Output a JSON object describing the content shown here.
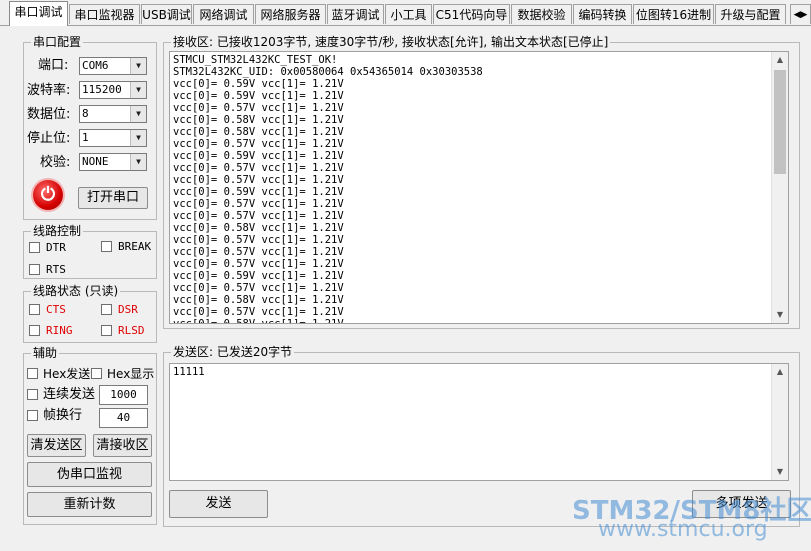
{
  "tabs": [
    "串口调试",
    "串口监视器",
    "USB调试",
    "网络调试",
    "网络服务器",
    "蓝牙调试",
    "小工具",
    "C51代码向导",
    "数据校验",
    "编码转换",
    "位图转16进制",
    "升级与配置"
  ],
  "serial_config": {
    "legend": "串口配置",
    "port_label": "端口:",
    "port_value": "COM6",
    "baud_label": "波特率:",
    "baud_value": "115200",
    "databits_label": "数据位:",
    "databits_value": "8",
    "stopbits_label": "停止位:",
    "stopbits_value": "1",
    "parity_label": "校验:",
    "parity_value": "NONE",
    "open_button": "打开串口"
  },
  "line_control": {
    "legend": "线路控制",
    "dtr": "DTR",
    "break": "BREAK",
    "rts": "RTS"
  },
  "line_status": {
    "legend": "线路状态 (只读)",
    "cts": "CTS",
    "dsr": "DSR",
    "ring": "RING",
    "rlsd": "RLSD"
  },
  "assist": {
    "legend": "辅助",
    "hex_send": "Hex发送",
    "hex_display": "Hex显示",
    "continuous_send": "连续发送",
    "continuous_interval": "1000",
    "frame_wrap": "帧换行",
    "frame_value": "40",
    "clear_send": "清发送区",
    "clear_receive": "清接收区",
    "pseudo_monitor": "伪串口监视",
    "recount": "重新计数"
  },
  "receive": {
    "legend": "接收区: 已接收1203字节, 速度30字节/秒, 接收状态[允许], 输出文本状态[已停止]",
    "lines": [
      "STMCU_STM32L432KC_TEST_OK!",
      "STM32L432KC_UID: 0x00580064 0x54365014 0x30303538",
      "vcc[0]= 0.59V vcc[1]= 1.21V",
      "vcc[0]= 0.59V vcc[1]= 1.21V",
      "vcc[0]= 0.57V vcc[1]= 1.21V",
      "vcc[0]= 0.58V vcc[1]= 1.21V",
      "vcc[0]= 0.58V vcc[1]= 1.21V",
      "vcc[0]= 0.57V vcc[1]= 1.21V",
      "vcc[0]= 0.59V vcc[1]= 1.21V",
      "vcc[0]= 0.57V vcc[1]= 1.21V",
      "vcc[0]= 0.57V vcc[1]= 1.21V",
      "vcc[0]= 0.59V vcc[1]= 1.21V",
      "vcc[0]= 0.57V vcc[1]= 1.21V",
      "vcc[0]= 0.57V vcc[1]= 1.21V",
      "vcc[0]= 0.58V vcc[1]= 1.21V",
      "vcc[0]= 0.57V vcc[1]= 1.21V",
      "vcc[0]= 0.57V vcc[1]= 1.21V",
      "vcc[0]= 0.57V vcc[1]= 1.21V",
      "vcc[0]= 0.59V vcc[1]= 1.21V",
      "vcc[0]= 0.57V vcc[1]= 1.21V",
      "vcc[0]= 0.58V vcc[1]= 1.21V",
      "vcc[0]= 0.57V vcc[1]= 1.21V",
      "vcc[0]= 0.58V vcc[1]= 1.21V",
      "vcc[0]= 0.57V vcc[1]= 1.21V",
      "vcc[0]= 0.59V vcc[1]= 1.21V"
    ]
  },
  "send": {
    "legend": "发送区: 已发送20字节",
    "content": "11111",
    "send_button": "发送",
    "multi_send_button": "多项发送"
  },
  "watermark": {
    "line1": "STM32/STM8社区",
    "line2": "www.stmcu.org"
  }
}
